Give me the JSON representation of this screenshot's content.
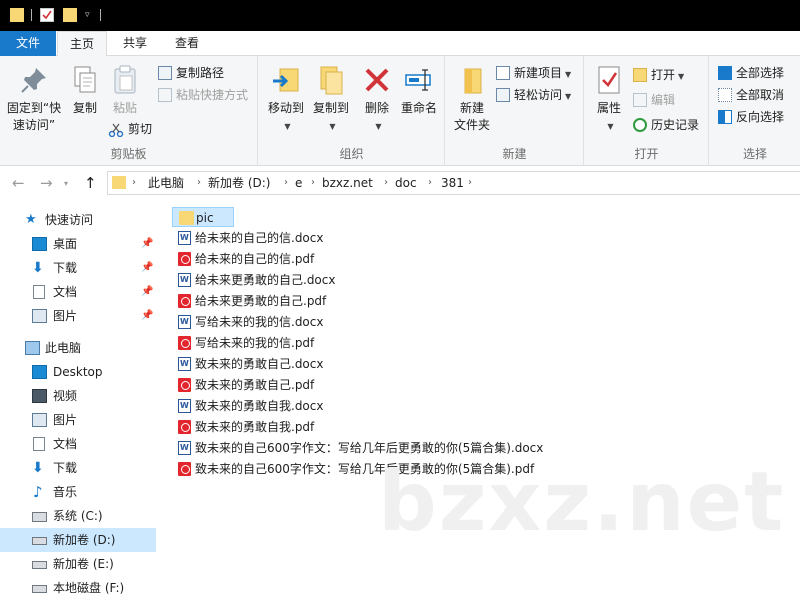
{
  "ribbon_tabs": {
    "file": "文件",
    "home": "主页",
    "share": "共享",
    "view": "查看"
  },
  "ribbon": {
    "clipboard": {
      "label": "剪贴板",
      "pin_quick_access": "固定到“快",
      "pin_quick_access_2": "速访问”",
      "copy": "复制",
      "paste": "粘贴",
      "copy_path": "复制路径",
      "paste_shortcut": "粘贴快捷方式",
      "cut": "剪切"
    },
    "organize": {
      "label": "组织",
      "move_to": "移动到",
      "copy_to": "复制到",
      "delete": "删除",
      "rename": "重命名"
    },
    "new": {
      "label": "新建",
      "new_folder": "新建",
      "new_folder_2": "文件夹",
      "new_item": "新建项目",
      "easy_access": "轻松访问"
    },
    "open": {
      "label": "打开",
      "properties": "属性",
      "open": "打开",
      "edit": "编辑",
      "history": "历史记录"
    },
    "select": {
      "label": "选择",
      "select_all": "全部选择",
      "select_none": "全部取消",
      "invert": "反向选择"
    }
  },
  "address": {
    "crumbs": [
      "此电脑",
      "新加卷 (D:)",
      "e",
      "bzxz.net",
      "doc",
      "381"
    ]
  },
  "nav": {
    "quick_access": "快速访问",
    "desktop_cn": "桌面",
    "downloads_1": "下载",
    "documents_1": "文档",
    "pictures_1": "图片",
    "this_pc": "此电脑",
    "desktop": "Desktop",
    "videos": "视频",
    "pictures_2": "图片",
    "documents_2": "文档",
    "downloads_2": "下载",
    "music": "音乐",
    "drive_c": "系统 (C:)",
    "drive_d": "新加卷 (D:)",
    "drive_e": "新加卷 (E:)",
    "drive_f": "本地磁盘 (F:)"
  },
  "files": [
    {
      "name": "pic",
      "type": "folder"
    },
    {
      "name": "给未来的自己的信.docx",
      "type": "docx"
    },
    {
      "name": "给未来的自己的信.pdf",
      "type": "pdf"
    },
    {
      "name": "给未来更勇敢的自己.docx",
      "type": "docx"
    },
    {
      "name": "给未来更勇敢的自己.pdf",
      "type": "pdf"
    },
    {
      "name": "写给未来的我的信.docx",
      "type": "docx"
    },
    {
      "name": "写给未来的我的信.pdf",
      "type": "pdf"
    },
    {
      "name": "致未来的勇敢自己.docx",
      "type": "docx"
    },
    {
      "name": "致未来的勇敢自己.pdf",
      "type": "pdf"
    },
    {
      "name": "致未来的勇敢自我.docx",
      "type": "docx"
    },
    {
      "name": "致未来的勇敢自我.pdf",
      "type": "pdf"
    },
    {
      "name": "致未来的自己600字作文：写给几年后更勇敢的你(5篇合集).docx",
      "type": "docx"
    },
    {
      "name": "致未来的自己600字作文：写给几年后更勇敢的你(5篇合集).pdf",
      "type": "pdf"
    }
  ],
  "watermark": "bzxz.net",
  "colors": {
    "accent": "#1979ca",
    "selection": "#cce8ff",
    "folder": "#f8d775",
    "pdf": "#e3262d",
    "word": "#2b579a"
  }
}
